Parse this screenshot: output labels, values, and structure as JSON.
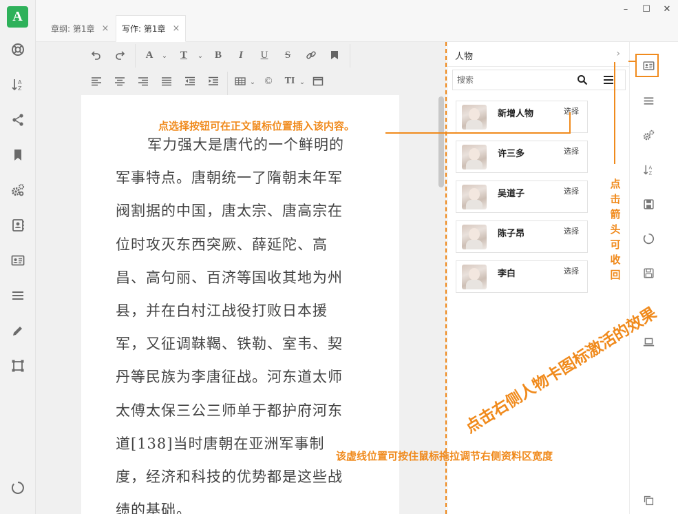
{
  "app": {
    "logo_text": "A",
    "accent_color": "#2eb15a",
    "annotation_color": "#f08a1c"
  },
  "tabs": [
    {
      "label": "章纲: 第1章",
      "active": false
    },
    {
      "label": "写作: 第1章",
      "active": true
    }
  ],
  "tab_close": "×",
  "window_controls": {
    "minimize": "–",
    "maximize": "☐",
    "close": "✕"
  },
  "left_sidebar_icons": [
    "lifebuoy-icon",
    "sort-az-icon",
    "share-icon",
    "bookmark-icon",
    "gears-icon",
    "contact-book-icon",
    "id-card-icon",
    "menu-lines-icon",
    "pencil-icon",
    "frame-icon",
    "circle-icon"
  ],
  "toolbar": {
    "row1": [
      "undo-icon",
      "redo-icon",
      "font-color-icon",
      "text-size-icon",
      "bold-icon",
      "italic-icon",
      "underline-icon",
      "strikethrough-icon",
      "link-icon",
      "bookmark-icon"
    ],
    "row2": [
      "align-left-icon",
      "align-center-icon",
      "align-right-icon",
      "align-justify-icon",
      "outdent-icon",
      "indent-icon",
      "table-icon",
      "copyright-icon",
      "text-style-icon",
      "window-icon"
    ],
    "glyphs": {
      "font_color": "A",
      "text_size": "T",
      "bold": "B",
      "italic": "I",
      "underline": "U",
      "strike": "S",
      "copyright": "©",
      "text_style": "TI"
    }
  },
  "editor": {
    "lines": [
      "军力强大是唐代的一个鲜明的",
      "军事特点。唐朝统一了隋朝末年军",
      "阀割据的中国，唐太宗、唐高宗在",
      "位时攻灭东西突厥、薛延陀、高",
      "昌、高句丽、百济等国收其地为州",
      "县，并在白村江战役打败日本援",
      "军，又征调靺鞨、铁勒、室韦、契",
      "丹等民族为李唐征战。河东道太师",
      "太傅太保三公三师单于都护府河东",
      "道[138]当时唐朝在亚洲军事制",
      "度，经济和科技的优势都是这些战",
      "绩的基础。"
    ]
  },
  "panel": {
    "title": "人物",
    "arrow": "›",
    "search_placeholder": "搜索",
    "select_label": "选择",
    "characters": [
      {
        "name": "新增人物"
      },
      {
        "name": "许三多"
      },
      {
        "name": "吴道子"
      },
      {
        "name": "陈子昂"
      },
      {
        "name": "李白"
      }
    ]
  },
  "right_bar_icons": [
    "id-card-icon",
    "menu-lines-icon",
    "gears-icon",
    "sort-az-icon",
    "save-disk-icon",
    "circle-icon",
    "floppy-icon",
    "laptop-icon",
    "copy-icon"
  ],
  "annotations": {
    "insert_hint": "点选择按钮可在正文鼠标位置插入该内容。",
    "collapse_hint": "点击箭头可收回",
    "activate_hint": "点击右侧人物卡图标激活的效果",
    "drag_hint": "该虚线位置可按住鼠标拖拉调节右侧资料区宽度"
  }
}
